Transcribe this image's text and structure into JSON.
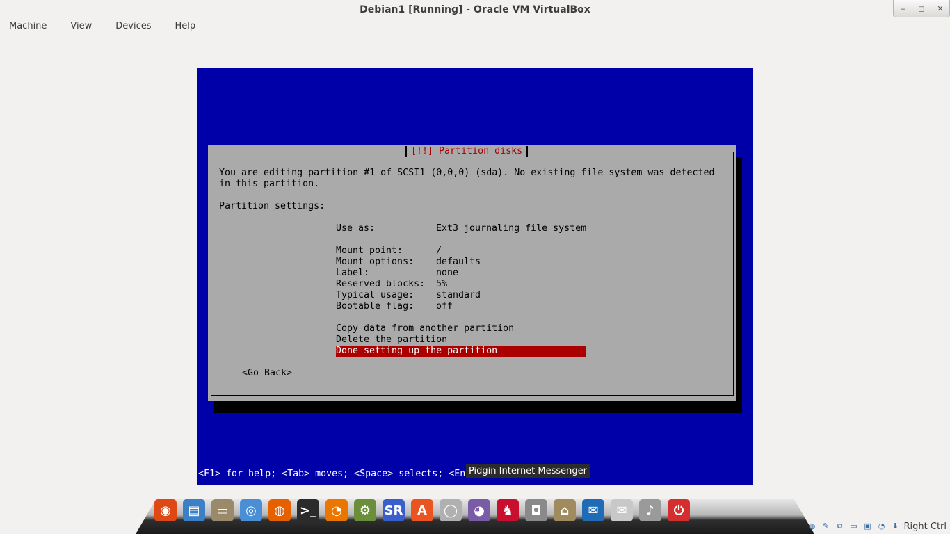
{
  "window": {
    "title": "Debian1 [Running] - Oracle VM VirtualBox",
    "minimize_glyph": "‒",
    "maximize_glyph": "◻",
    "close_glyph": "✕"
  },
  "menubar": {
    "items": [
      "Machine",
      "View",
      "Devices",
      "Help"
    ]
  },
  "installer": {
    "dialog_title": "[!!] Partition disks",
    "intro_line1": "You are editing partition #1 of SCSI1 (0,0,0) (sda). No existing file system was detected",
    "intro_line2": "in this partition.",
    "settings_heading": "Partition settings:",
    "settings": [
      {
        "key": "Use as:",
        "value": "Ext3 journaling file system"
      },
      {
        "key": "Mount point:",
        "value": "/"
      },
      {
        "key": "Mount options:",
        "value": "defaults"
      },
      {
        "key": "Label:",
        "value": "none"
      },
      {
        "key": "Reserved blocks:",
        "value": "5%"
      },
      {
        "key": "Typical usage:",
        "value": "standard"
      },
      {
        "key": "Bootable flag:",
        "value": "off"
      }
    ],
    "actions": [
      "Copy data from another partition",
      "Delete the partition",
      "Done setting up the partition"
    ],
    "selected_action": "Done setting up the partition",
    "go_back": "<Go Back>",
    "status_line": "<F1> for help; <Tab> moves; <Space> selects; <Ent"
  },
  "tooltip": {
    "text": "Pidgin Internet Messenger"
  },
  "dock": {
    "icons": [
      {
        "name": "ubuntu-icon",
        "glyph": "◉",
        "color": "#dd4814"
      },
      {
        "name": "system-monitor-icon",
        "glyph": "▤",
        "color": "#3b7fc4"
      },
      {
        "name": "files-icon",
        "glyph": "▭",
        "color": "#9a8a6a"
      },
      {
        "name": "chromium-icon",
        "glyph": "◎",
        "color": "#4a8fd6"
      },
      {
        "name": "firefox-icon",
        "glyph": "◍",
        "color": "#e66000"
      },
      {
        "name": "terminal-icon",
        "glyph": ">_",
        "color": "#2b2b2b"
      },
      {
        "name": "blender-icon",
        "glyph": "◔",
        "color": "#ea7600"
      },
      {
        "name": "settings-icon",
        "glyph": "⚙",
        "color": "#6b8e3a"
      },
      {
        "name": "simplescreenrecorder-icon",
        "glyph": "SR",
        "color": "#3a5fcd"
      },
      {
        "name": "app-store-icon",
        "glyph": "A",
        "color": "#e95420"
      },
      {
        "name": "disk-icon",
        "glyph": "◯",
        "color": "#b0b0b0"
      },
      {
        "name": "pidgin-icon",
        "glyph": "◕",
        "color": "#7a5ba6"
      },
      {
        "name": "supertux-icon",
        "glyph": "♞",
        "color": "#c8102e"
      },
      {
        "name": "camera-icon",
        "glyph": "◘",
        "color": "#8a8a8a"
      },
      {
        "name": "home-folder-icon",
        "glyph": "⌂",
        "color": "#a08b5e"
      },
      {
        "name": "thunderbird-icon",
        "glyph": "✉",
        "color": "#1f6bb5"
      },
      {
        "name": "mail-icon",
        "glyph": "✉",
        "color": "#c8c8c8"
      },
      {
        "name": "volume-icon",
        "glyph": "♪",
        "color": "#9a9a9a"
      },
      {
        "name": "power-icon",
        "glyph": "⏻",
        "color": "#d32f2f"
      }
    ]
  },
  "tray": {
    "right_ctrl": "Right Ctrl"
  }
}
